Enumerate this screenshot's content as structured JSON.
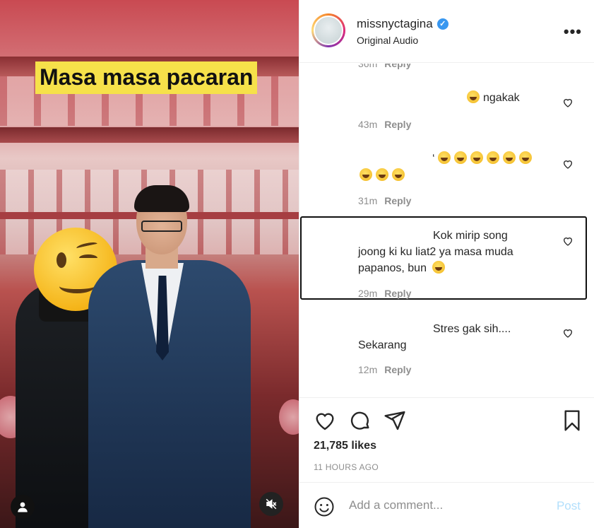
{
  "media": {
    "caption": "Masa masa pacaran"
  },
  "header": {
    "username": "missnyctagina",
    "verified_glyph": "✓",
    "subtitle": "Original Audio",
    "more_glyph": "•••"
  },
  "comments": [
    {
      "text_line1": "",
      "text_line2": "ngakak",
      "time": "43m",
      "reply": "Reply",
      "emoji_count_line1": 1
    },
    {
      "text_prefix": "‘",
      "time": "31m",
      "reply": "Reply",
      "emoji_count_line1": 6,
      "emoji_count_line2": 3
    },
    {
      "text_line1": "Kok mirip song",
      "text_line2": "joong ki ku liat2 ya masa muda",
      "text_line3": "papanos, bun",
      "time": "29m",
      "reply": "Reply"
    },
    {
      "text_line1": "Stres gak sih....",
      "text_line2": "Sekarang",
      "time": "12m",
      "reply": "Reply"
    }
  ],
  "clipped_comment": {
    "time": "36m",
    "reply": "Reply"
  },
  "actions": {
    "likes": "21,785 likes",
    "time_ago": "11 HOURS AGO"
  },
  "add_comment": {
    "placeholder": "Add a comment...",
    "post_label": "Post"
  },
  "colors": {
    "verified": "#3897f0",
    "post_disabled": "#b2dffc",
    "muted_text": "#8e8e8e"
  }
}
